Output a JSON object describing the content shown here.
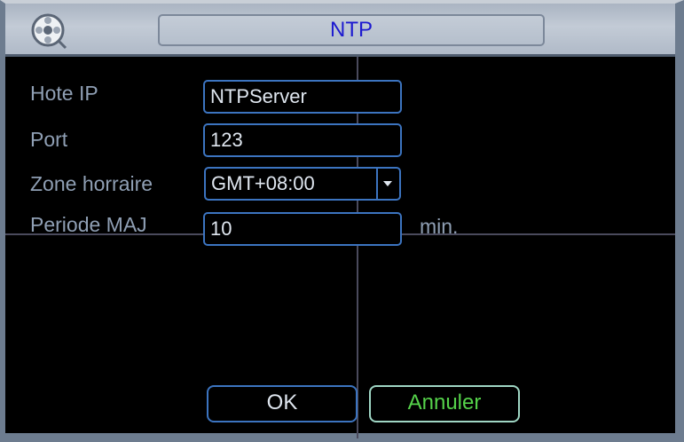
{
  "dialog": {
    "title": "NTP"
  },
  "form": {
    "host_ip": {
      "label": "Hote IP",
      "value": "NTPServer"
    },
    "port": {
      "label": "Port",
      "value": "123"
    },
    "timezone": {
      "label": "Zone horraire",
      "value": "GMT+08:00"
    },
    "update_period": {
      "label": "Periode MAJ",
      "value": "10",
      "unit": "min."
    }
  },
  "buttons": {
    "ok_label": "OK",
    "cancel_label": "Annuler"
  },
  "icons": {
    "logo": "film-reel-icon",
    "dropdown": "chevron-down-icon"
  },
  "colors": {
    "title_text": "#1d1ad0",
    "label_text": "#8f9fb4",
    "field_border": "#3c74c0",
    "cancel_text": "#55d24a"
  }
}
